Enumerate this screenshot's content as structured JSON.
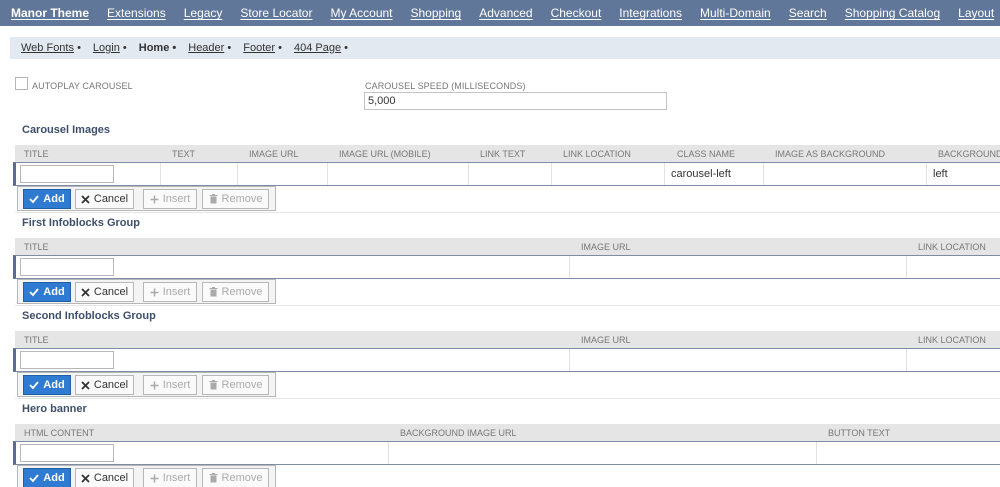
{
  "nav": {
    "items": [
      "Manor Theme",
      "Extensions",
      "Legacy",
      "Store Locator",
      "My Account",
      "Shopping",
      "Advanced",
      "Checkout",
      "Integrations",
      "Multi-Domain",
      "Search",
      "Shopping Catalog",
      "Layout"
    ]
  },
  "subtabs": {
    "items": [
      "Web Fonts",
      "Login",
      "Home",
      "Header",
      "Footer",
      "404 Page"
    ],
    "bullet": "•",
    "active": "Home"
  },
  "settings": {
    "autoplay_label": "AUTOPLAY CAROUSEL",
    "autoplay_checked": false,
    "speed_label": "CAROUSEL SPEED (MILLISECONDS)",
    "speed_value": "5,000"
  },
  "buttons": {
    "add": "Add",
    "cancel": "Cancel",
    "insert": "Insert",
    "remove": "Remove"
  },
  "carousel": {
    "title": "Carousel Images",
    "columns": [
      "TITLE",
      "TEXT",
      "IMAGE URL",
      "IMAGE URL (MOBILE)",
      "LINK TEXT",
      "LINK LOCATION",
      "CLASS NAME",
      "IMAGE AS BACKGROUND",
      "BACKGROUND C"
    ],
    "row": [
      "",
      "",
      "",
      "",
      "",
      "",
      "carousel-left",
      "",
      "left"
    ]
  },
  "infoblocks1": {
    "title": "First Infoblocks Group",
    "columns": [
      "TITLE",
      "IMAGE URL",
      "LINK LOCATION"
    ]
  },
  "infoblocks2": {
    "title": "Second Infoblocks Group",
    "columns": [
      "TITLE",
      "IMAGE URL",
      "LINK LOCATION"
    ]
  },
  "hero": {
    "title": "Hero banner",
    "columns": [
      "HTML CONTENT",
      "BACKGROUND IMAGE URL",
      "BUTTON TEXT"
    ]
  },
  "colors": {
    "nav_bg": "#607799",
    "subtab_bg": "#e2e9f1",
    "add_button": "#2e7bd1",
    "section_title": "#3e4f6a"
  }
}
